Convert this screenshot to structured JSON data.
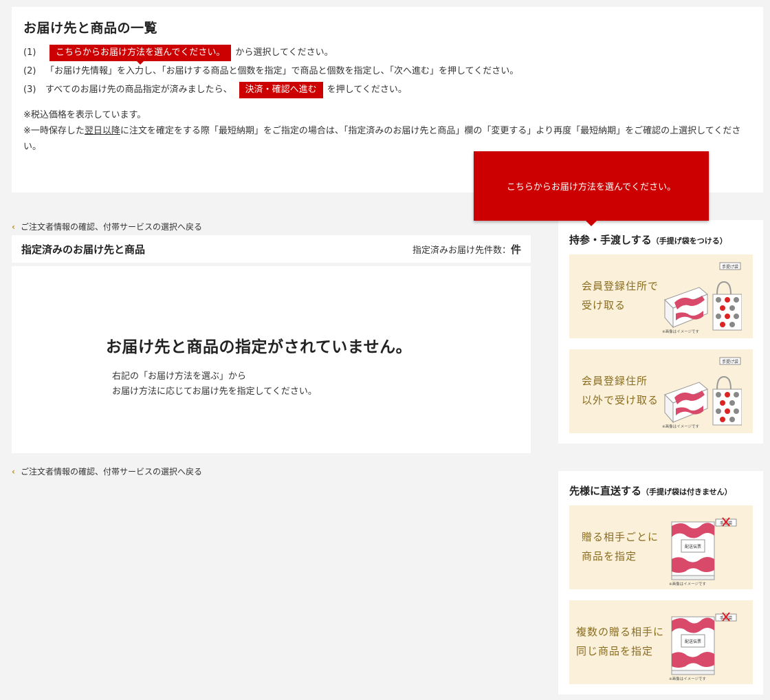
{
  "intro": {
    "title": "お届け先と商品の一覧",
    "step1_num": "(1)",
    "step1_button": "こちらからお届け方法を選んでください。",
    "step1_after": "から選択してください。",
    "step2_num": "(2)",
    "step2_text": "「お届け先情報」を入力し、「お届けする商品と個数を指定」で商品と個数を指定し、「次へ進む」を押してください。",
    "step3_num": "(3)",
    "step3_before": "すべてのお届け先の商品指定が済みましたら、",
    "step3_button": "決済・確認へ進む",
    "step3_after": "を押してください。",
    "note1": "※税込価格を表示しています。",
    "note2_pre": "※一時保存した",
    "note2_link": "翌日以降",
    "note2_post": "に注文を確定をする際「最短納期」をご指定の場合は、「指定済みのお届け先と商品」欄の「変更する」より再度「最短納期」をご確認の上選択してください。"
  },
  "tooltip": "こちらからお届け方法を選んでください。",
  "back_link": "ご注文者情報の確認、付帯サービスの選択へ戻る",
  "specified": {
    "title": "指定済みのお届け先と商品",
    "count_label": "指定済みお届け先件数：",
    "count_unit": "件",
    "empty_title": "お届け先と商品の指定がされていません。",
    "empty_line1": "右記の「お届け方法を選ぶ」から",
    "empty_line2": "お届け方法に応じてお届け先を指定してください。"
  },
  "handover": {
    "title": "持参・手渡しする",
    "note": "（手提げ袋をつける）",
    "options": [
      {
        "line1": "会員登録住所で",
        "line2": "受け取る",
        "bag_tag": "手提げ袋",
        "caption": "※画像はイメージです"
      },
      {
        "line1": "会員登録住所",
        "line2": "以外で受け取る",
        "bag_tag": "手提げ袋",
        "caption": "※画像はイメージです"
      }
    ]
  },
  "direct": {
    "title": "先様に直送する",
    "note": "（手提げ袋は付きません）",
    "options": [
      {
        "line1": "贈る相手ごとに",
        "line2": "商品を指定",
        "slip": "配送伝票",
        "bag_tag": "手提袋",
        "caption": "※画像はイメージです"
      },
      {
        "line1": "複数の贈る相手に",
        "line2": "同じ商品を指定",
        "slip": "配送伝票",
        "bag_tag": "手提袋",
        "caption": "※画像はイメージです"
      }
    ]
  },
  "colors": {
    "accent": "#cc0000",
    "option_bg": "#fbf0d9",
    "option_text": "#8a6d1f",
    "chevron": "#b88a2e"
  }
}
